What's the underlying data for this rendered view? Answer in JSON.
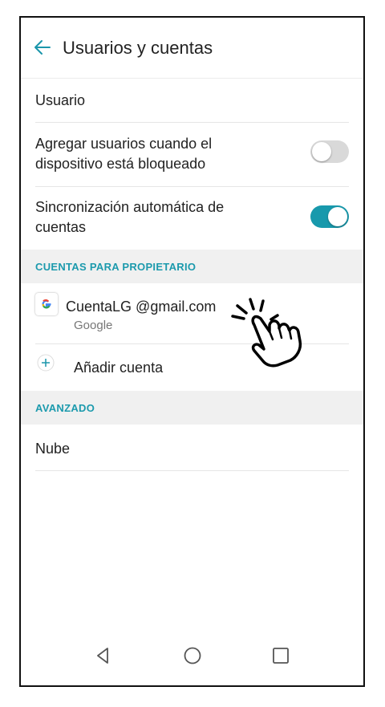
{
  "header": {
    "title": "Usuarios y cuentas",
    "back_icon": "arrow-left-icon"
  },
  "settings": {
    "user_label": "Usuario",
    "add_users_label_line1": "Agregar usuarios cuando el",
    "add_users_label_line2": "dispositivo está bloqueado",
    "add_users_enabled": false,
    "auto_sync_label_line1": "Sincronización automática de",
    "auto_sync_label_line2": "cuentas",
    "auto_sync_enabled": true
  },
  "owner_accounts": {
    "section_title": "CUENTAS PARA PROPIETARIO",
    "account_email": "CuentaLG @gmail.com",
    "account_provider": "Google",
    "add_account_label": "Añadir cuenta"
  },
  "advanced": {
    "section_title": "AVANZADO",
    "cloud_label": "Nube"
  },
  "navbar": {
    "back": "triangle-back-icon",
    "home": "circle-home-icon",
    "recents": "square-recents-icon"
  },
  "colors": {
    "accent": "#1899ac",
    "section_bg": "#f0f0f0",
    "toggle_off": "#d9d9d9"
  }
}
